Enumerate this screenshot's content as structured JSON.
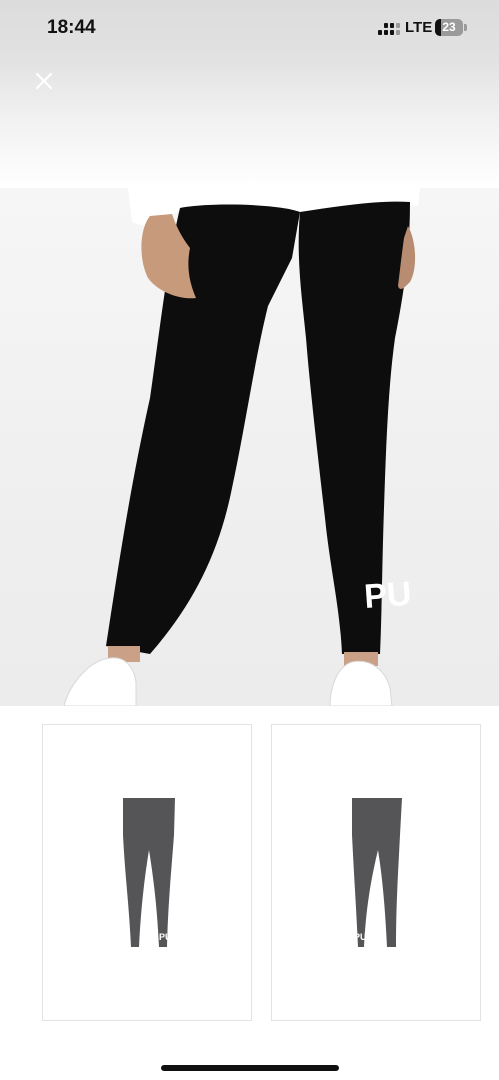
{
  "status_bar": {
    "time": "18:44",
    "network": "LTE",
    "battery_level": "23",
    "battery_fraction": 0.23,
    "icons": [
      "signal-icon",
      "battery-icon"
    ]
  },
  "header": {
    "close_icon": "close-icon"
  },
  "gallery": {
    "main_image": {
      "subject": "black leggings on model",
      "logo_text": "PU"
    },
    "thumbnails": [
      {
        "subject": "grey leggings back view",
        "logo_text": "PU"
      },
      {
        "subject": "grey leggings front view",
        "logo_text": "PU"
      }
    ]
  },
  "colors": {
    "legging_main": "#0d0d0d",
    "legging_thumb": "#555557",
    "background": "#ffffff"
  }
}
